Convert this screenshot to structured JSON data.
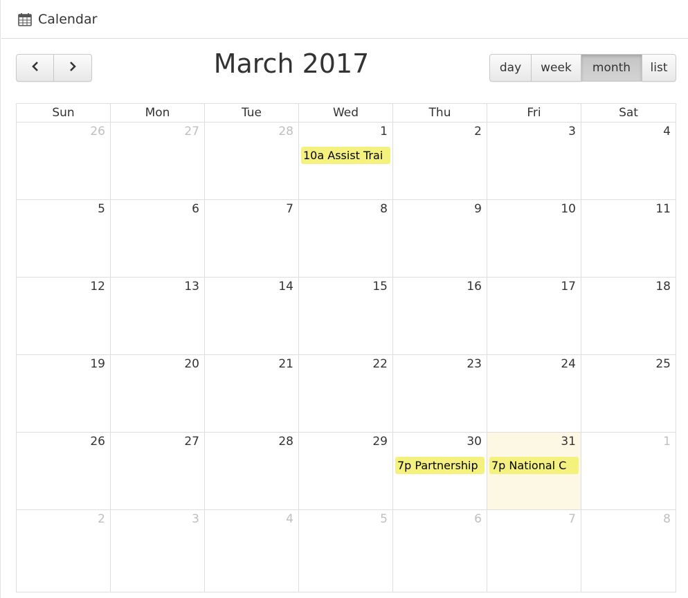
{
  "panel": {
    "title": "Calendar",
    "icon": "calendar-icon"
  },
  "toolbar": {
    "prev_icon": "chevron-left-icon",
    "next_icon": "chevron-right-icon",
    "title": "March 2017",
    "views": [
      "day",
      "week",
      "month",
      "list"
    ],
    "active_view": "month"
  },
  "weekdays": [
    "Sun",
    "Mon",
    "Tue",
    "Wed",
    "Thu",
    "Fri",
    "Sat"
  ],
  "weeks": [
    [
      "26",
      "27",
      "28",
      "1",
      "2",
      "3",
      "4"
    ],
    [
      "5",
      "6",
      "7",
      "8",
      "9",
      "10",
      "11"
    ],
    [
      "12",
      "13",
      "14",
      "15",
      "16",
      "17",
      "18"
    ],
    [
      "19",
      "20",
      "21",
      "22",
      "23",
      "24",
      "25"
    ],
    [
      "26",
      "27",
      "28",
      "29",
      "30",
      "31",
      "1"
    ],
    [
      "2",
      "3",
      "4",
      "5",
      "6",
      "7",
      "8"
    ]
  ],
  "events": {
    "mar1": "10a Assist Trai",
    "mar30": "7p Partnership",
    "mar31": "7p National C"
  },
  "colors": {
    "event": "#f4f17e",
    "today": "#fcf8e3",
    "other_month_text": "#bfbfbf",
    "border": "#dddddd"
  }
}
